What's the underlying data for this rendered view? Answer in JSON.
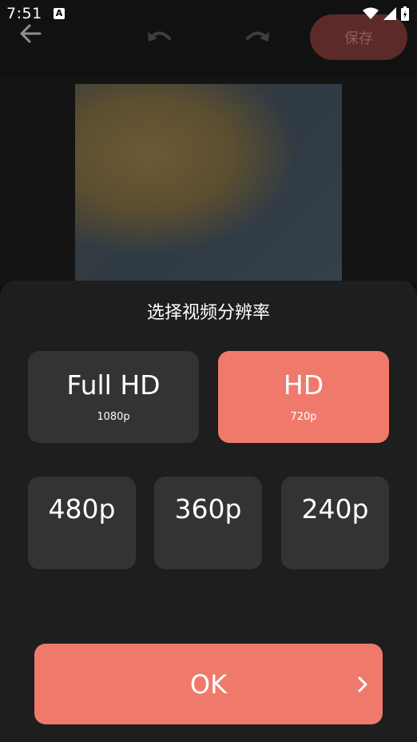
{
  "status_bar": {
    "time": "7:51",
    "notification_icon": "A",
    "icons": [
      "wifi-icon",
      "signal-icon",
      "battery-icon"
    ]
  },
  "toolbar": {
    "back_icon": "arrow-left-icon",
    "undo_icon": "undo-icon",
    "redo_icon": "redo-icon",
    "save_label": "保存"
  },
  "sheet": {
    "title": "选择视频分辨率",
    "options": [
      {
        "label": "Full HD",
        "sub": "1080p",
        "selected": false
      },
      {
        "label": "HD",
        "sub": "720p",
        "selected": true
      },
      {
        "label": "480p",
        "sub": "",
        "selected": false
      },
      {
        "label": "360p",
        "sub": "",
        "selected": false
      },
      {
        "label": "240p",
        "sub": "",
        "selected": false
      }
    ],
    "ok_label": "OK"
  },
  "colors": {
    "accent": "#ef7a6b",
    "card": "#333333",
    "sheet_bg": "#1e1e1e",
    "save_disabled_bg": "#5b2a29"
  }
}
